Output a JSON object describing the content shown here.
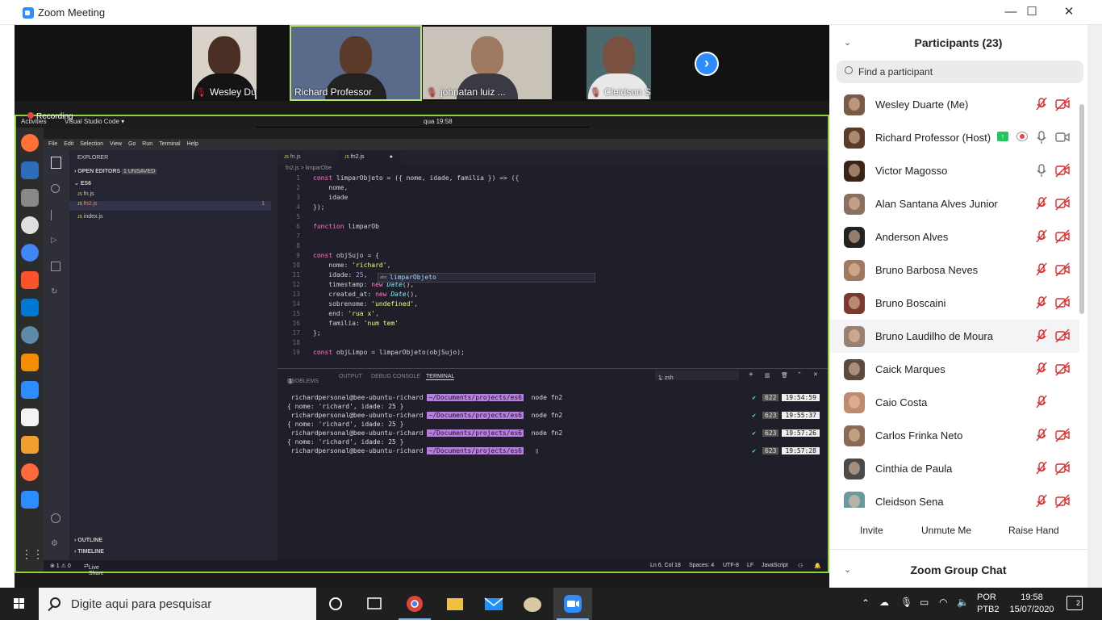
{
  "window": {
    "title": "Zoom Meeting"
  },
  "thumbnails": [
    {
      "name": "Wesley Duarte"
    },
    {
      "name": "Richard Professor"
    },
    {
      "name": "johnatan luiz ..."
    },
    {
      "name": "Cleidson Sena"
    }
  ],
  "shared_screen": {
    "recording_label": "Recording",
    "gnome": {
      "activities": "Activities",
      "app": "Visual Studio Code ▾",
      "clock": "qua 19:58"
    },
    "vscode": {
      "menu": [
        "File",
        "Edit",
        "Selection",
        "View",
        "Go",
        "Run",
        "Terminal",
        "Help"
      ],
      "explorer_title": "EXPLORER",
      "open_editors": "OPEN EDITORS",
      "unsaved": "1 UNSAVED",
      "folder": "ES6",
      "files": [
        {
          "name": "fn.js",
          "badge": ""
        },
        {
          "name": "fn2.js",
          "badge": "1"
        },
        {
          "name": "index.js",
          "badge": ""
        }
      ],
      "outline": "OUTLINE",
      "timeline": "TIMELINE",
      "tabs": [
        "fn.js",
        "fn2.js"
      ],
      "breadcrumb": "fn2.js > limparObe",
      "code_lines": [
        "const limparObjeto = ({ nome, idade, familia }) => ({",
        "    nome,",
        "    idade",
        "});",
        "",
        "function limparOb",
        "",
        "",
        "const objSujo = {",
        "    nome: 'richard',",
        "    idade: 25,",
        "    timestamp: new Date(),",
        "    created_at: new Date(),",
        "    sobrenome: 'undefined',",
        "    end: 'rua x',",
        "    familia: 'num tem'",
        "};",
        "",
        "const objLimpo = limparObjeto(objSujo);"
      ],
      "suggestion": "limparObjeto",
      "panel_tabs": [
        "PROBLEMS",
        "OUTPUT",
        "DEBUG CONSOLE",
        "TERMINAL"
      ],
      "problems_count": "1",
      "terminal_select": "1: zsh",
      "terminal": [
        {
          "prompt": "richardpersonal@bee-ubuntu-richard",
          "path": "~/Documents/projects/es6",
          "cmd": "node fn2",
          "count": "622",
          "time": "19:54:59"
        },
        {
          "output": "{ nome: 'richard', idade: 25 }"
        },
        {
          "prompt": "richardpersonal@bee-ubuntu-richard",
          "path": "~/Documents/projects/es6",
          "cmd": "node fn2",
          "count": "623",
          "time": "19:55:37"
        },
        {
          "output": "{ nome: 'richard', idade: 25 }"
        },
        {
          "prompt": "richardpersonal@bee-ubuntu-richard",
          "path": "~/Documents/projects/es6",
          "cmd": "node fn2",
          "count": "623",
          "time": "19:57:26"
        },
        {
          "output": "{ nome: 'richard', idade: 25 }"
        },
        {
          "prompt": "richardpersonal@bee-ubuntu-richard",
          "path": "~/Documents/projects/es6",
          "cmd": "",
          "count": "623",
          "time": "19:57:28"
        }
      ],
      "status": {
        "errors": "⊗ 1 ⚠ 0",
        "liveshare": "Live Share",
        "position": "Ln 6, Col 18",
        "spaces": "Spaces: 4",
        "encoding": "UTF-8",
        "eol": "LF",
        "language": "JavaScript"
      }
    }
  },
  "participants": {
    "title": "Participants (23)",
    "search_placeholder": "Find a participant",
    "list": [
      {
        "name": "Wesley Duarte (Me)",
        "mic": "muted",
        "cam": "off"
      },
      {
        "name": "Richard Professor (Host)",
        "mic": "on",
        "cam": "on",
        "sharing": true,
        "recording": true
      },
      {
        "name": "Victor Magosso",
        "mic": "on",
        "cam": "off"
      },
      {
        "name": "Alan Santana Alves Junior",
        "mic": "muted",
        "cam": "off"
      },
      {
        "name": "Anderson Alves",
        "mic": "muted",
        "cam": "off"
      },
      {
        "name": "Bruno Barbosa Neves",
        "mic": "muted",
        "cam": "off"
      },
      {
        "name": "Bruno Boscaini",
        "mic": "muted",
        "cam": "off"
      },
      {
        "name": "Bruno Laudilho de Moura",
        "mic": "muted",
        "cam": "off",
        "highlight": true
      },
      {
        "name": "Caick Marques",
        "mic": "muted",
        "cam": "off"
      },
      {
        "name": "Caio Costa",
        "mic": "muted",
        "cam": "none"
      },
      {
        "name": "Carlos Frinka Neto",
        "mic": "muted",
        "cam": "off"
      },
      {
        "name": "Cinthia de Paula",
        "mic": "muted",
        "cam": "off"
      },
      {
        "name": "Cleidson Sena",
        "mic": "muted",
        "cam": "off"
      }
    ],
    "buttons": {
      "invite": "Invite",
      "unmute": "Unmute Me",
      "raise_hand": "Raise Hand"
    }
  },
  "chat": {
    "title": "Zoom Group Chat"
  },
  "taskbar": {
    "search_placeholder": "Digite aqui para pesquisar",
    "lang_line1": "POR",
    "lang_line2": "PTB2",
    "time": "19:58",
    "date": "15/07/2020",
    "notifications": "2"
  },
  "colors": {
    "zoom_blue": "#2d8cff",
    "muted_red": "#e02828",
    "share_green": "#8fd13c"
  }
}
